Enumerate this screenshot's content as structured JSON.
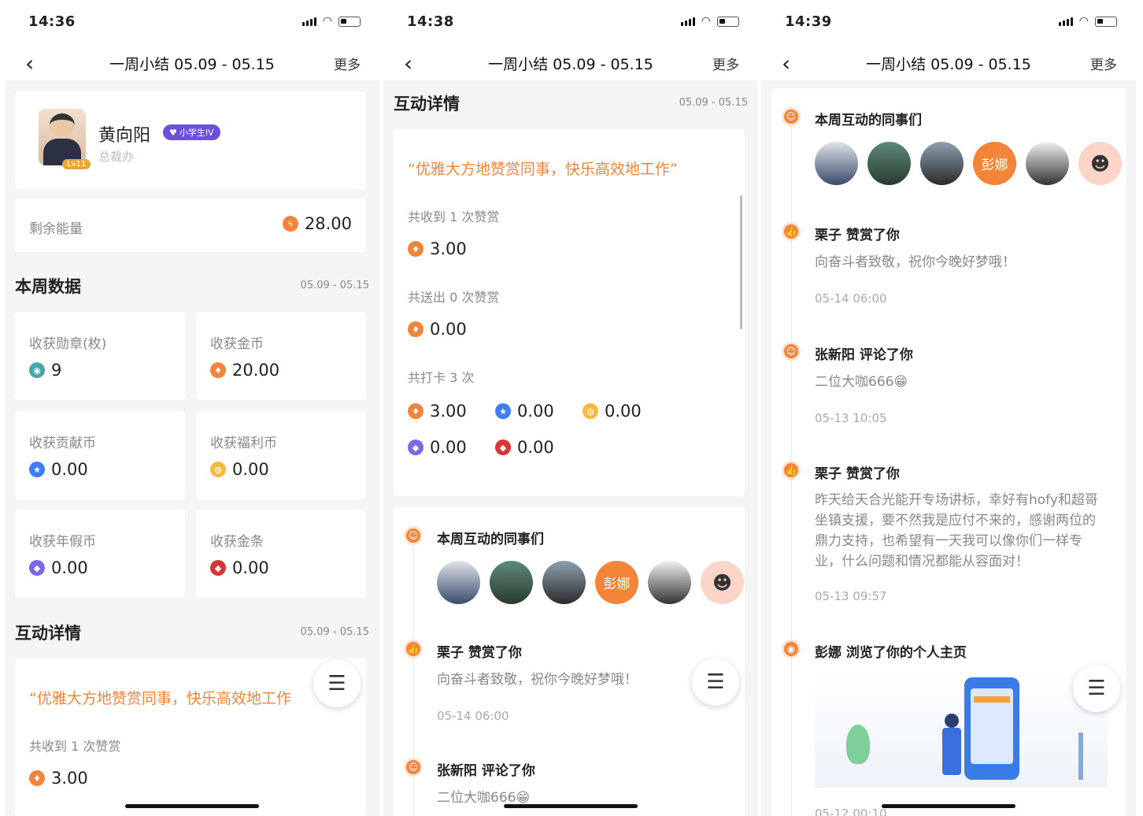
{
  "status": {
    "times": [
      "14:36",
      "14:38",
      "14:39"
    ]
  },
  "nav": {
    "title": "一周小结 05.09 - 05.15",
    "more": "更多",
    "back": "‹"
  },
  "profile": {
    "name": "黄向阳",
    "badge": "小学生IV",
    "dept": "总裁办",
    "level": "Lv11"
  },
  "energy": {
    "label": "剩余能量",
    "value": "28.00"
  },
  "weekly": {
    "title": "本周数据",
    "date": "05.09 - 05.15",
    "stats": [
      {
        "label": "收获勋章(枚)",
        "value": "9"
      },
      {
        "label": "收获金币",
        "value": "20.00"
      },
      {
        "label": "收获贡献币",
        "value": "0.00"
      },
      {
        "label": "收获福利币",
        "value": "0.00"
      },
      {
        "label": "收获年假币",
        "value": "0.00"
      },
      {
        "label": "收获金条",
        "value": "0.00"
      }
    ]
  },
  "interaction": {
    "title": "互动详情",
    "date": "05.09 - 05.15",
    "slogan": "“优雅大方地赞赏同事，快乐高效地工作”",
    "slogan_cut": "“优雅大方地赞赏同事，快乐高效地工作",
    "received_label": "共收到 1 次赞赏",
    "received_value": "3.00",
    "sent_label": "共送出 0 次赞赏",
    "sent_value": "0.00",
    "checkin_label": "共打卡 3 次",
    "checkin_values": [
      "3.00",
      "0.00",
      "0.00",
      "0.00",
      "0.00"
    ]
  },
  "timeline": {
    "colleagues_title": "本周互动的同事们",
    "avatar_text": "彭娜",
    "items": [
      {
        "title": "栗子 赞赏了你",
        "text": "向奋斗者致敬，祝你今晚好梦哦！",
        "time": "05-14 06:00"
      },
      {
        "title": "张新阳 评论了你",
        "text": "二位大咖666😁",
        "time": "05-13 10:05"
      },
      {
        "title": "栗子 赞赏了你",
        "text": "昨天给天合光能开专场讲标，幸好有hofy和超哥坐镇支援，要不然我是应付不来的，感谢两位的鼎力支持，也希望有一天我可以像你们一样专业，什么问题和情况都能从容面对！",
        "time": "05-13 09:57"
      },
      {
        "title": "彭娜 浏览了你的个人主页",
        "text": "",
        "time": ""
      }
    ],
    "cut_text": "二位大咖666😁",
    "cut_time": "05-12 00:10"
  },
  "icons": {
    "menu": "☰",
    "coin": "♦",
    "star": "★"
  }
}
